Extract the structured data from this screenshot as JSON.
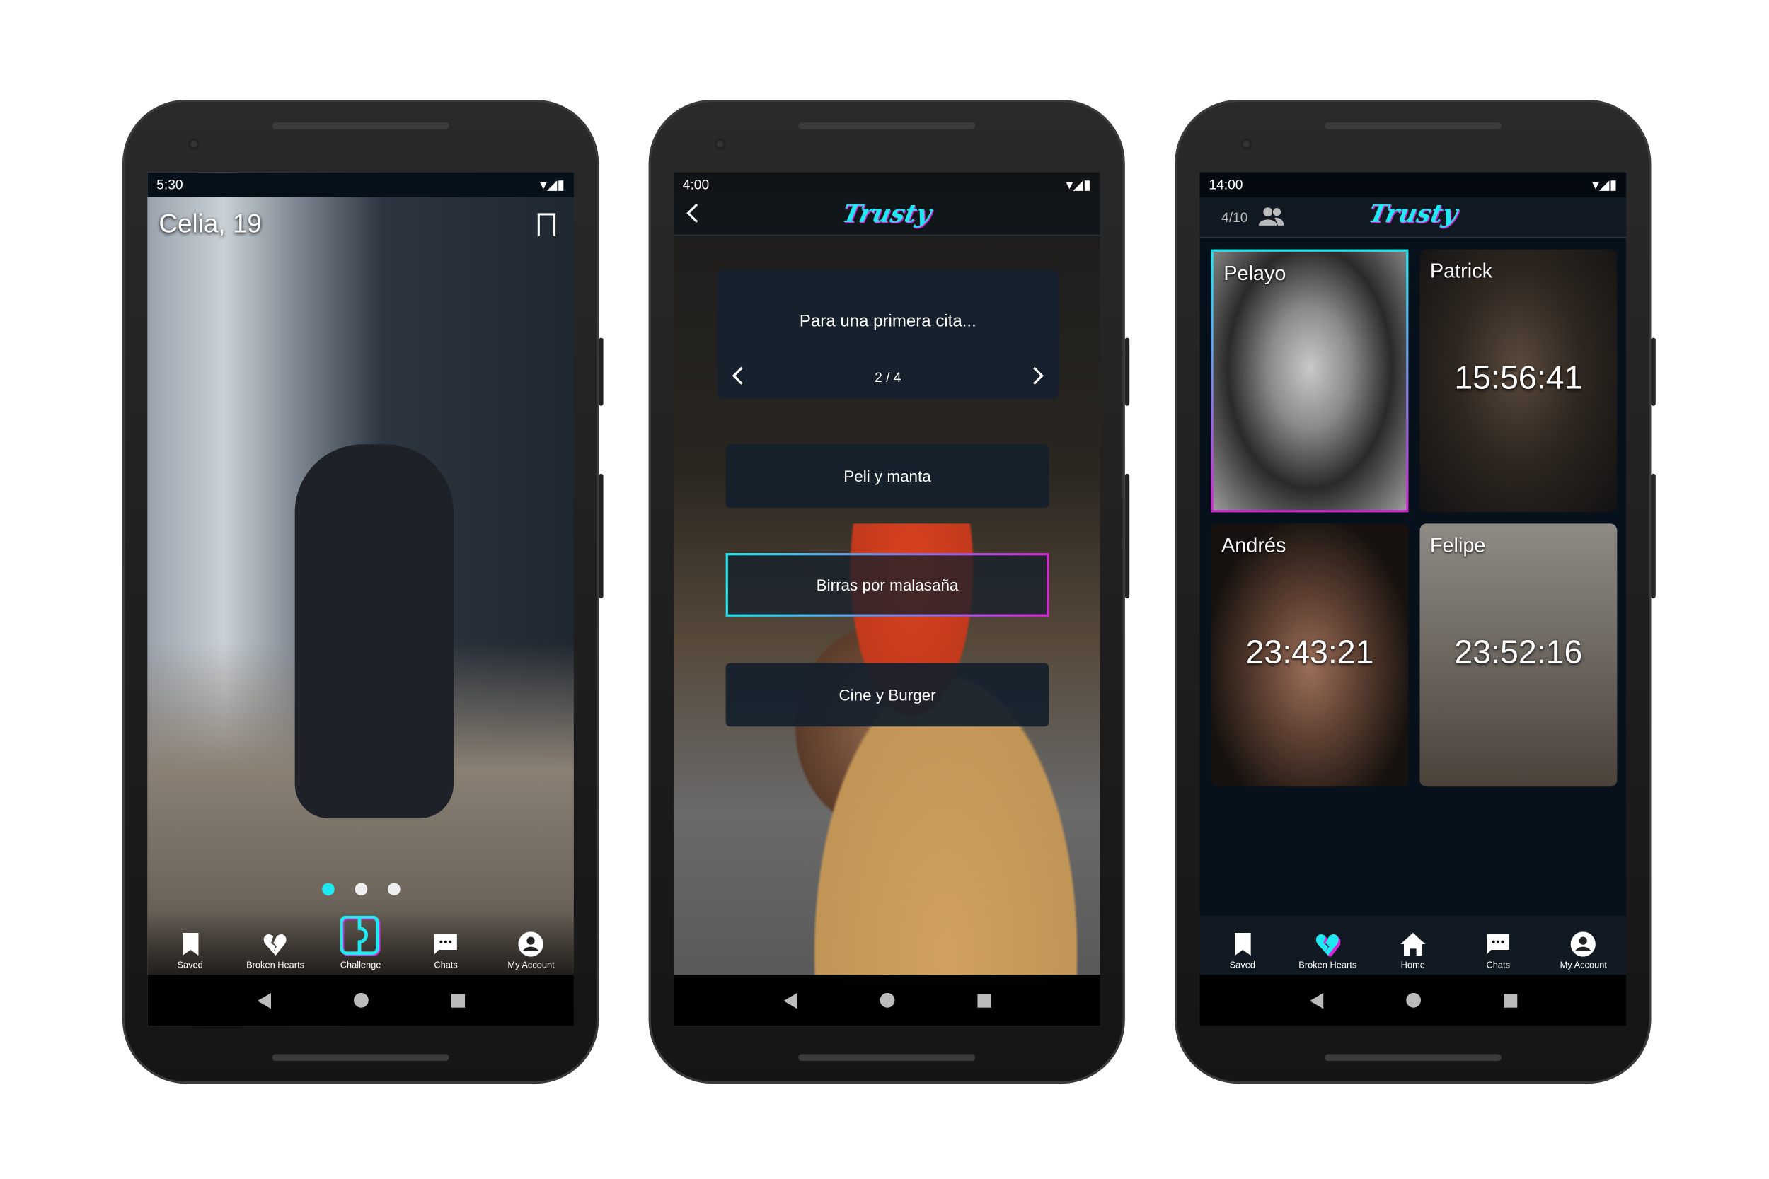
{
  "colors": {
    "accent_cyan": "#1ee8f0",
    "accent_magenta": "#d626d6",
    "background": "#06111b"
  },
  "phone1": {
    "status": {
      "time": "5:30"
    },
    "profile": {
      "name": "Celia, 19",
      "bookmark_icon": "bookmark-icon"
    },
    "carousel": {
      "pages": 3,
      "active": 1
    },
    "nav": [
      {
        "label": "Saved",
        "icon": "bookmark-icon"
      },
      {
        "label": "Broken Hearts",
        "icon": "broken-heart-icon"
      },
      {
        "label": "Challenge",
        "icon": "challenge-icon",
        "active": true
      },
      {
        "label": "Chats",
        "icon": "chat-icon"
      },
      {
        "label": "My Account",
        "icon": "account-icon"
      }
    ]
  },
  "phone2": {
    "status": {
      "time": "4:00"
    },
    "header": {
      "logo": "Trusty"
    },
    "question": {
      "text": "Para una primera cita...",
      "pager": "2 / 4"
    },
    "options": [
      {
        "label": "Peli y manta"
      },
      {
        "label": "Birras por malasaña",
        "selected": true
      },
      {
        "label": "Cine y Burger"
      }
    ]
  },
  "phone3": {
    "status": {
      "time": "14:00"
    },
    "header": {
      "logo": "Trusty",
      "count": "4/10"
    },
    "cards": [
      {
        "name": "Pelayo",
        "timer": "",
        "selected": true
      },
      {
        "name": "Patrick",
        "timer": "15:56:41"
      },
      {
        "name": "Andrés",
        "timer": "23:43:21"
      },
      {
        "name": "Felipe",
        "timer": "23:52:16"
      }
    ],
    "nav": [
      {
        "label": "Saved",
        "icon": "bookmark-icon"
      },
      {
        "label": "Broken Hearts",
        "icon": "broken-heart-icon",
        "active": true
      },
      {
        "label": "Home",
        "icon": "home-icon"
      },
      {
        "label": "Chats",
        "icon": "chat-icon"
      },
      {
        "label": "My Account",
        "icon": "account-icon"
      }
    ]
  }
}
